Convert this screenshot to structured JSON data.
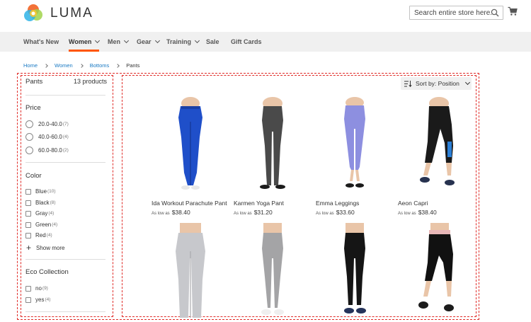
{
  "header": {
    "brand": "LUMA",
    "search_placeholder": "Search entire store here...",
    "colors": {
      "logo": [
        "#f26322",
        "#a1d34b",
        "#2eb3e6",
        "#f8c832"
      ]
    }
  },
  "nav": {
    "items": [
      {
        "label": "What's New",
        "has_menu": false,
        "active": false
      },
      {
        "label": "Women",
        "has_menu": true,
        "active": true
      },
      {
        "label": "Men",
        "has_menu": true,
        "active": false
      },
      {
        "label": "Gear",
        "has_menu": true,
        "active": false
      },
      {
        "label": "Training",
        "has_menu": true,
        "active": false
      },
      {
        "label": "Sale",
        "has_menu": false,
        "active": false
      },
      {
        "label": "Gift Cards",
        "has_menu": false,
        "active": false
      }
    ],
    "accent_color": "#ff5501"
  },
  "breadcrumb": {
    "items": [
      "Home",
      "Women",
      "Bottoms"
    ],
    "current": "Pants"
  },
  "sidebar": {
    "title": "Pants",
    "count": "13 products",
    "price": {
      "title": "Price",
      "options": [
        {
          "label": "20.0-40.0",
          "count": "(7)"
        },
        {
          "label": "40.0-60.0",
          "count": "(4)"
        },
        {
          "label": "60.0-80.0",
          "count": "(2)"
        }
      ]
    },
    "color": {
      "title": "Color",
      "options": [
        {
          "label": "Blue",
          "count": "(10)"
        },
        {
          "label": "Black",
          "count": "(8)"
        },
        {
          "label": "Gray",
          "count": "(4)"
        },
        {
          "label": "Green",
          "count": "(4)"
        },
        {
          "label": "Red",
          "count": "(4)"
        }
      ],
      "show_more": "Show more"
    },
    "eco": {
      "title": "Eco Collection",
      "options": [
        {
          "label": "no",
          "count": "(9)"
        },
        {
          "label": "yes",
          "count": "(4)"
        }
      ]
    }
  },
  "sorter": {
    "label": "Sort by: Position"
  },
  "products": {
    "price_prefix": "As low as",
    "items": [
      {
        "name": "Ida Workout Parachute Pant",
        "price": "$38.40",
        "color": "#1f4fc9"
      },
      {
        "name": "Karmen Yoga Pant",
        "price": "$31.20",
        "color": "#4a4a4a"
      },
      {
        "name": "Emma Leggings",
        "price": "$33.60",
        "color": "#8d8fe0"
      },
      {
        "name": "Aeon Capri",
        "price": "$38.40",
        "color": "#1a1a1a"
      },
      {
        "name": "",
        "price": "",
        "color": "#c7c8cc"
      },
      {
        "name": "",
        "price": "",
        "color": "#a4a4a6"
      },
      {
        "name": "",
        "price": "",
        "color": "#151515"
      },
      {
        "name": "",
        "price": "",
        "color": "#111111"
      }
    ]
  }
}
